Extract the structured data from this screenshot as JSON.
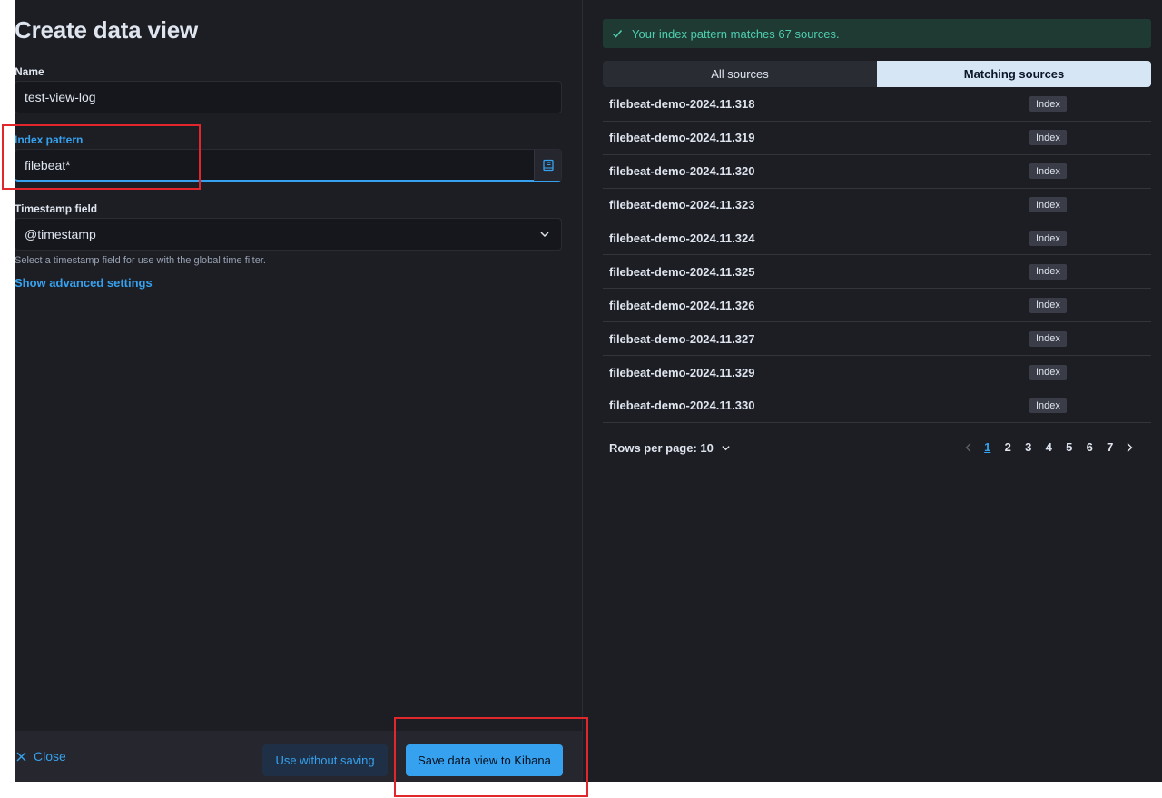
{
  "form": {
    "title": "Create data view",
    "name_label": "Name",
    "name_value": "test-view-log",
    "index_label": "Index pattern",
    "index_value": "filebeat*",
    "timestamp_label": "Timestamp field",
    "timestamp_value": "@timestamp",
    "timestamp_help": "Select a timestamp field for use with the global time filter.",
    "advanced_link": "Show advanced settings"
  },
  "footer": {
    "close_label": "Close",
    "use_without_saving_label": "Use without saving",
    "save_label": "Save data view to Kibana"
  },
  "preview": {
    "callout": "Your index pattern matches 67 sources.",
    "tabs": [
      "All sources",
      "Matching sources"
    ],
    "selected_tab": "Matching sources",
    "sources": [
      {
        "name": "filebeat-demo-2024.11.318",
        "type": "Index"
      },
      {
        "name": "filebeat-demo-2024.11.319",
        "type": "Index"
      },
      {
        "name": "filebeat-demo-2024.11.320",
        "type": "Index"
      },
      {
        "name": "filebeat-demo-2024.11.323",
        "type": "Index"
      },
      {
        "name": "filebeat-demo-2024.11.324",
        "type": "Index"
      },
      {
        "name": "filebeat-demo-2024.11.325",
        "type": "Index"
      },
      {
        "name": "filebeat-demo-2024.11.326",
        "type": "Index"
      },
      {
        "name": "filebeat-demo-2024.11.327",
        "type": "Index"
      },
      {
        "name": "filebeat-demo-2024.11.329",
        "type": "Index"
      },
      {
        "name": "filebeat-demo-2024.11.330",
        "type": "Index"
      }
    ],
    "rows_per_page": "Rows per page: 10",
    "pages": [
      "1",
      "2",
      "3",
      "4",
      "5",
      "6",
      "7"
    ],
    "current_page": "1"
  },
  "colors": {
    "accent": "#36a2ef",
    "success": "#4ecfb0",
    "annotation": "#e1262c",
    "background": "#1d1e24"
  },
  "icons": {
    "callout": "check-icon",
    "index_append": "book-icon",
    "timestamp_select": "chevron-down-icon",
    "close": "cross-icon",
    "prev_page": "chevron-left-icon",
    "next_page": "chevron-right-icon"
  }
}
